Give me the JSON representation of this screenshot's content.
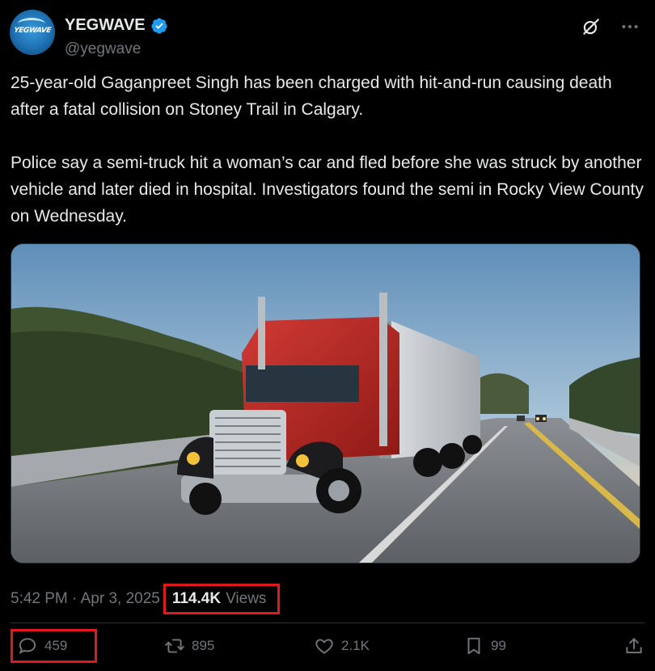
{
  "author": {
    "display_name": "YEGWAVE",
    "handle": "@yegwave",
    "avatar_logo": "YEGWAVE",
    "verified": true
  },
  "top_actions": [
    "grok-icon",
    "more-icon"
  ],
  "tweet": {
    "text": "25-year-old Gaganpreet Singh has been charged with hit-and-run causing death after a fatal collision on Stoney Trail in Calgary.\n\nPolice say a semi-truck hit a woman’s car and fled before she was struck by another vehicle and later died in hospital. Investigators found the semi in Rocky View County on Wednesday."
  },
  "meta": {
    "timestamp": "5:42 PM · Apr 3, 2025",
    "separator": "·",
    "views_count": "114.4K",
    "views_label": "Views"
  },
  "actions": {
    "reply": "459",
    "retweet": "895",
    "like": "2.1K",
    "bookmark": "99"
  },
  "colors": {
    "background": "#000000",
    "text": "#e7e9ea",
    "muted": "#71767b",
    "highlight_box": "#e0191c",
    "verified": "#1d9bf0"
  }
}
